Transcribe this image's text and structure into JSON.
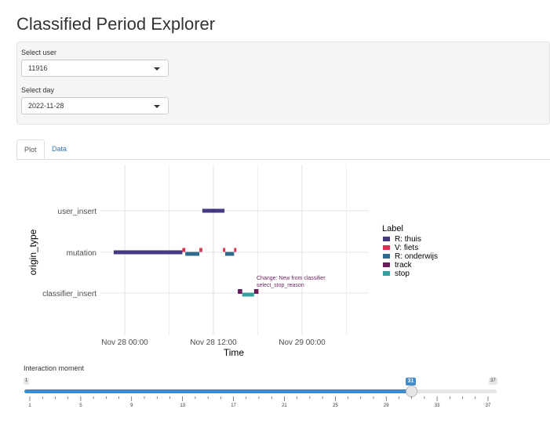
{
  "page_title": "Classified Period Explorer",
  "user_select": {
    "label": "Select user",
    "value": "11916"
  },
  "day_select": {
    "label": "Select day",
    "value": "2022-11-28"
  },
  "tabs": [
    {
      "label": "Plot",
      "active": true
    },
    {
      "label": "Data",
      "active": false
    }
  ],
  "chart_data": {
    "type": "gantt",
    "xlabel": "Time",
    "ylabel": "origin_type",
    "x_ticks": [
      "Nov 28 00:00",
      "Nov 28 12:00",
      "Nov 29 00:00"
    ],
    "y_categories": [
      "user_insert",
      "mutation",
      "classifier_insert"
    ],
    "legend_title": "Label",
    "legend": [
      {
        "name": "R: thuis",
        "color": "#443a83"
      },
      {
        "name": "V: fiets",
        "color": "#dc3050"
      },
      {
        "name": "R: onderwijs",
        "color": "#31688e"
      },
      {
        "name": "track",
        "color": "#6b1d5d"
      },
      {
        "name": "stop",
        "color": "#35a1a0"
      }
    ],
    "annotation": [
      "Change: New from classifier",
      "select_stop_reason"
    ],
    "segments": [
      {
        "row": "user_insert",
        "label": "R: thuis",
        "start_h": 10.5,
        "end_h": 13.5
      },
      {
        "row": "mutation",
        "label": "R: thuis",
        "start_h": -1.5,
        "end_h": 7.8
      },
      {
        "row": "mutation",
        "label": "V: fiets",
        "start_h": 7.8,
        "end_h": 8.2
      },
      {
        "row": "mutation",
        "label": "R: onderwijs",
        "start_h": 8.2,
        "end_h": 10.1
      },
      {
        "row": "mutation",
        "label": "V: fiets",
        "start_h": 10.1,
        "end_h": 10.5
      },
      {
        "row": "mutation",
        "label": "V: fiets",
        "start_h": 13.3,
        "end_h": 13.6
      },
      {
        "row": "mutation",
        "label": "R: onderwijs",
        "start_h": 13.6,
        "end_h": 14.8
      },
      {
        "row": "mutation",
        "label": "V: fiets",
        "start_h": 14.8,
        "end_h": 15.1
      },
      {
        "row": "classifier_insert",
        "label": "track",
        "start_h": 15.3,
        "end_h": 15.9
      },
      {
        "row": "classifier_insert",
        "label": "stop",
        "start_h": 15.9,
        "end_h": 17.5
      },
      {
        "row": "classifier_insert",
        "label": "track",
        "start_h": 17.5,
        "end_h": 18.1
      }
    ]
  },
  "slider": {
    "label": "Interaction moment",
    "min": "1",
    "max": "37",
    "value": "31",
    "ticks": [
      "1",
      "5",
      "9",
      "13",
      "17",
      "21",
      "25",
      "29",
      "33",
      "37"
    ]
  }
}
